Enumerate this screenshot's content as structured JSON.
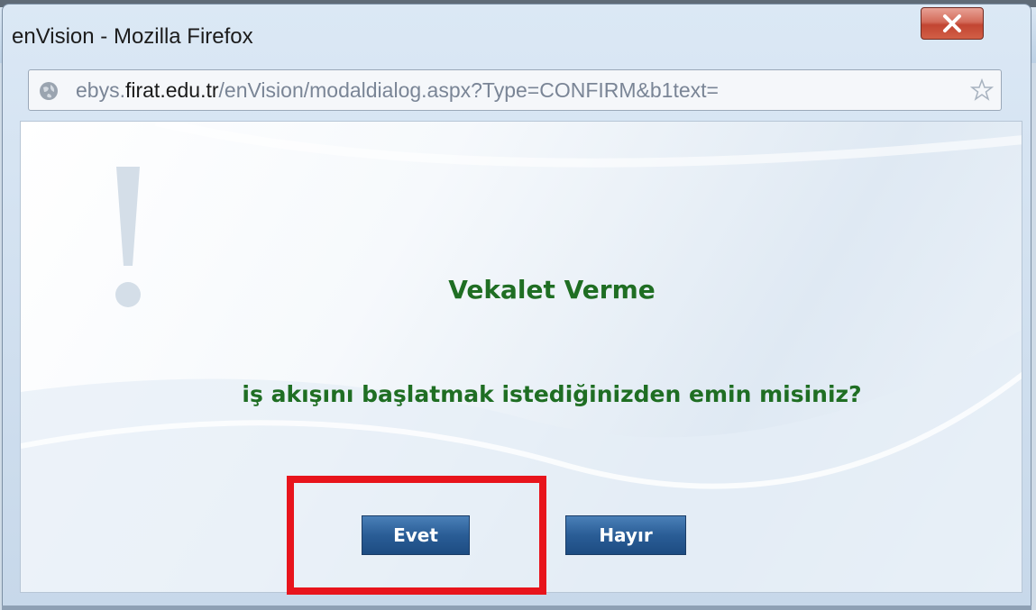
{
  "window": {
    "title": "enVision - Mozilla Firefox"
  },
  "address_bar": {
    "url_prefix": "ebys.",
    "url_domain": "firat.edu.tr",
    "url_path": "/enVision/modaldialog.aspx?Type=CONFIRM&b1text="
  },
  "dialog": {
    "title": "Vekalet Verme",
    "message": "iş akışını başlatmak istediğinizden emin misiniz?",
    "yes_label": "Evet",
    "no_label": "Hayır"
  },
  "colors": {
    "accent_text": "#1f6e23",
    "button": "#2a5d96",
    "highlight": "#e8141c"
  }
}
